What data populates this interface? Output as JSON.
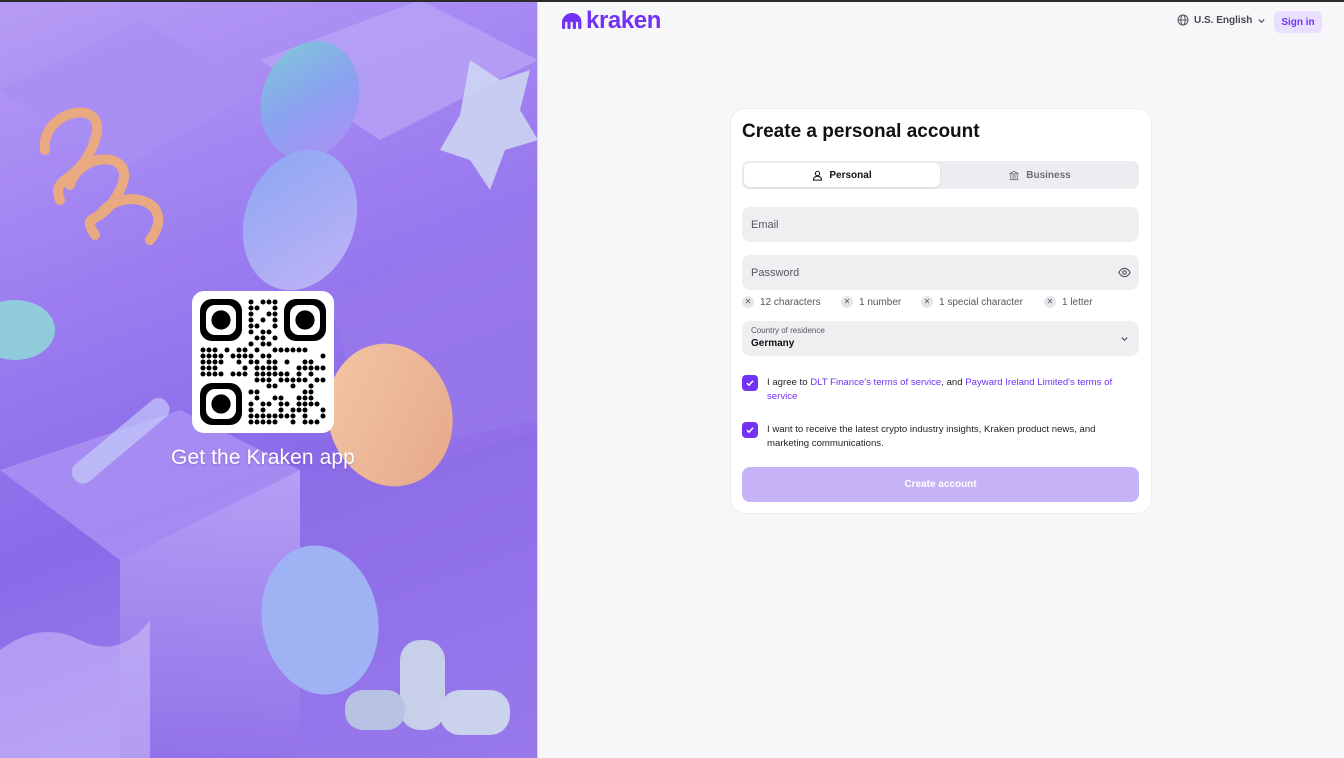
{
  "hero": {
    "caption": "Get the Kraken app",
    "qr_alt": "QR code to download the Kraken app"
  },
  "header": {
    "logo_text": "kraken",
    "language": "U.S. English",
    "signin_label": "Sign in"
  },
  "form": {
    "title": "Create a personal account",
    "tabs": [
      {
        "label": "Personal",
        "icon": "user-icon",
        "active": true
      },
      {
        "label": "Business",
        "icon": "bank-icon",
        "active": false
      }
    ],
    "email_placeholder": "Email",
    "password_placeholder": "Password",
    "password_rules": [
      "12 characters",
      "1 number",
      "1 special character",
      "1 letter"
    ],
    "country": {
      "label": "Country of residence",
      "value": "Germany"
    },
    "agree": {
      "prefix": "I agree to ",
      "link1": "DLT Finance's terms of service",
      "middle": ", and ",
      "link2": "Payward Ireland Limited's terms of service",
      "checked": true
    },
    "marketing": {
      "text": "I want to receive the latest crypto industry insights, Kraken product news, and marketing communications.",
      "checked": true
    },
    "submit_label": "Create account"
  },
  "colors": {
    "brand": "#7132f5",
    "submit_disabled": "#c6b3f7",
    "signin_bg": "#e9e0ff"
  }
}
